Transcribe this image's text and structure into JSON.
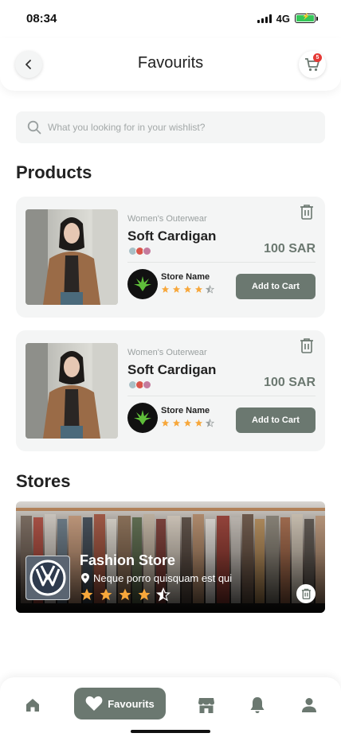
{
  "status_bar": {
    "time": "08:34",
    "network": "4G",
    "battery_color": "#35c759"
  },
  "header": {
    "title": "Favourits",
    "back_icon": "chevron-left-icon",
    "cart_icon": "cart-icon",
    "cart_badge": "5"
  },
  "search": {
    "placeholder": "What you looking for in your wishlist?",
    "value": "",
    "icon": "search-icon"
  },
  "products_section": {
    "title": "Products",
    "items": [
      {
        "category": "Women's Outerwear",
        "name": "Soft Cardigan",
        "price": "100 SAR",
        "colors": [
          "#a9c0c6",
          "#d9554a",
          "#c47b9d"
        ],
        "store_name": "Store Name",
        "rating": 4.5,
        "add_to_cart_label": "Add to Cart"
      },
      {
        "category": "Women's Outerwear",
        "name": "Soft Cardigan",
        "price": "100 SAR",
        "colors": [
          "#a9c0c6",
          "#d9554a",
          "#c47b9d"
        ],
        "store_name": "Store Name",
        "rating": 4.5,
        "add_to_cart_label": "Add to Cart"
      }
    ]
  },
  "stores_section": {
    "title": "Stores",
    "items": [
      {
        "name": "Fashion Store",
        "location": "Neque porro quisquam est qui",
        "rating": 4.5,
        "logo_icon": "volkswagen-logo"
      }
    ]
  },
  "bottom_nav": {
    "active_label": "Favourits",
    "items": [
      "home-icon",
      "heart-icon",
      "store-icon",
      "bell-icon",
      "user-icon"
    ]
  },
  "colors": {
    "accent": "#6b7870",
    "star": "#f7a73b",
    "card_bg": "#f4f5f5"
  }
}
